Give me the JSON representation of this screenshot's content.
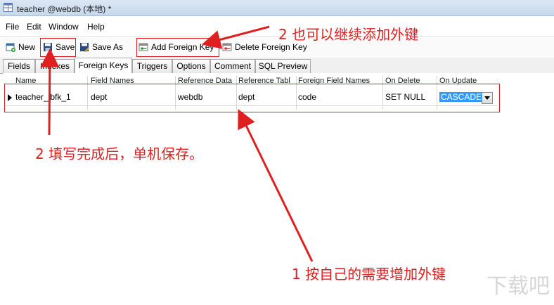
{
  "window": {
    "title": "teacher @webdb (本地) *"
  },
  "menu": [
    "File",
    "Edit",
    "Window",
    "Help"
  ],
  "toolbar": {
    "new_label": "New",
    "save_label": "Save",
    "save_as_label": "Save As",
    "add_fk_label": "Add Foreign Key",
    "delete_fk_label": "Delete Foreign Key"
  },
  "tabs": [
    "Fields",
    "Indexes",
    "Foreign Keys",
    "Triggers",
    "Options",
    "Comment",
    "SQL Preview"
  ],
  "active_tab": "Foreign Keys",
  "grid": {
    "columns": [
      "Name",
      "Field Names",
      "Reference Data",
      "Reference Tabl",
      "Foreign Field Names",
      "On Delete",
      "On Update"
    ],
    "row": {
      "name": "teacher_ibfk_1",
      "field_names": "dept",
      "reference_db": "webdb",
      "reference_table": "dept",
      "foreign_field": "code",
      "on_delete": "SET NULL",
      "on_update": "CASCADE"
    }
  },
  "annotations": {
    "a1": "2 也可以继续添加外键",
    "a2": "2 填写完成后，单机保存。",
    "a3": "1 按自己的需要增加外键"
  },
  "watermark": "下载吧",
  "colors": {
    "annotation": "#e02020",
    "selection": "#3399ff"
  }
}
